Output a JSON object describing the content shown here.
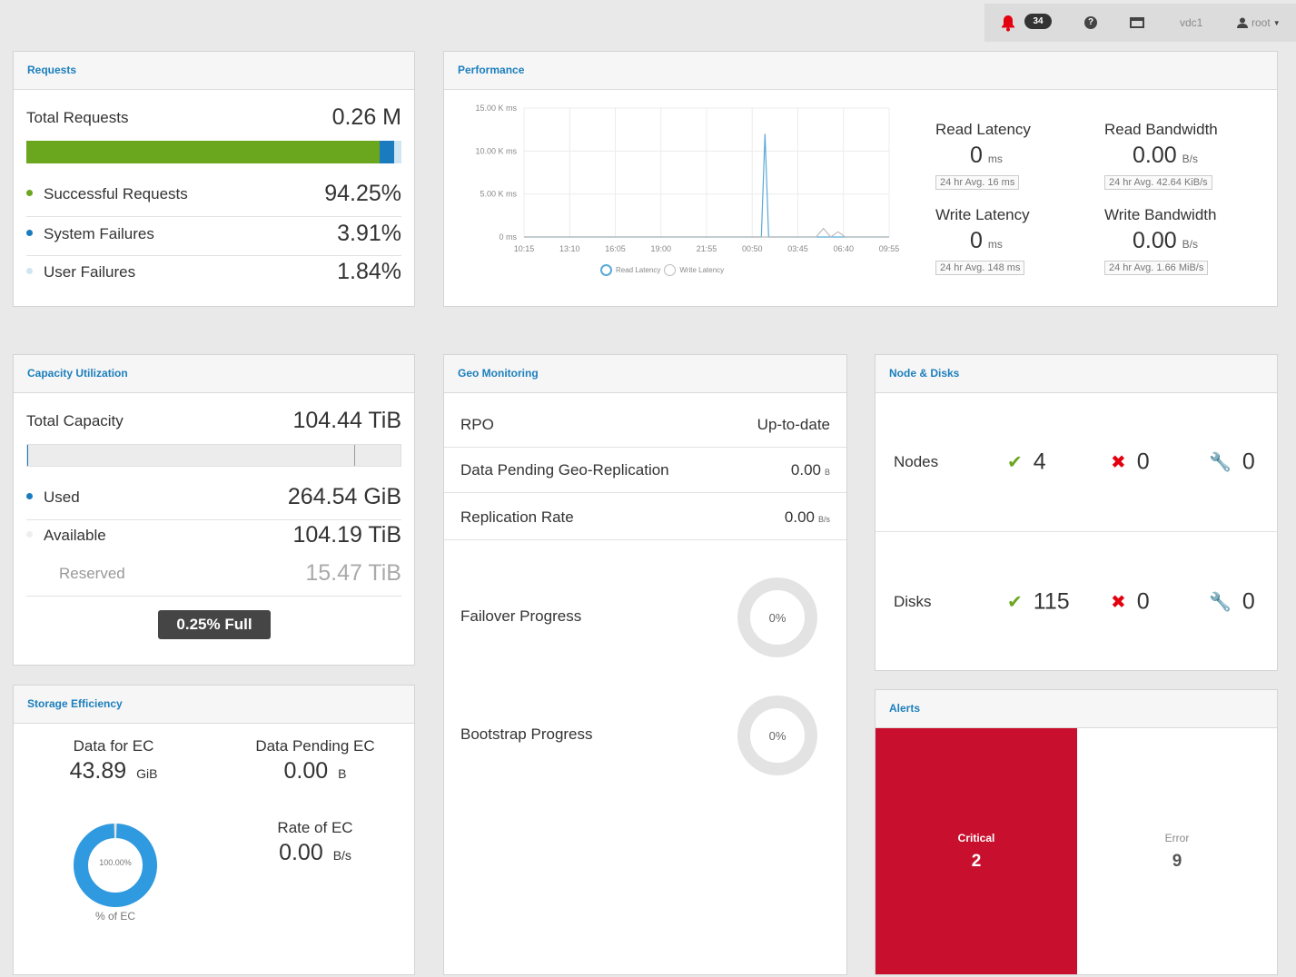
{
  "topbar": {
    "alert_count": "34",
    "vdc": "vdc1",
    "user": "root"
  },
  "requests": {
    "title": "Requests",
    "total_label": "Total Requests",
    "total_value": "0.26 M",
    "bar_fractions": {
      "success": 0.9425,
      "system": 0.0391,
      "user": 0.0184
    },
    "successful_label": "Successful Requests",
    "successful_value": "94.25%",
    "system_label": "System Failures",
    "system_value": "3.91%",
    "user_label": "User Failures",
    "user_value": "1.84%",
    "colors": {
      "success": "#6aa61e",
      "system": "#1a7bbf",
      "user": "#cfe6f2"
    }
  },
  "performance": {
    "title": "Performance",
    "read_latency_label": "Read Latency",
    "read_latency_value": "0",
    "read_latency_unit": "ms",
    "read_latency_avg": "24 hr Avg. 16 ms",
    "write_latency_label": "Write Latency",
    "write_latency_value": "0",
    "write_latency_unit": "ms",
    "write_latency_avg": "24 hr Avg. 148 ms",
    "read_bw_label": "Read Bandwidth",
    "read_bw_value": "0.00",
    "read_bw_unit": "B/s",
    "read_bw_avg": "24 hr Avg. 42.64 KiB/s",
    "write_bw_label": "Write Bandwidth",
    "write_bw_value": "0.00",
    "write_bw_unit": "B/s",
    "write_bw_avg": "24 hr Avg. 1.66 MiB/s",
    "legend_read": "Read Latency",
    "legend_write": "Write Latency"
  },
  "chart_data": {
    "type": "line",
    "x": [
      "10:15",
      "13:10",
      "16:05",
      "19:00",
      "21:55",
      "00:50",
      "03:45",
      "06:40",
      "09:55"
    ],
    "yticks": [
      "15.00 K ms",
      "10.00 K ms",
      "5.00 K ms",
      "0 ms"
    ],
    "ylim": [
      0,
      15000
    ],
    "series": [
      {
        "name": "Read Latency",
        "color": "#5aa9d6",
        "points": [
          [
            0,
            0
          ],
          [
            0.65,
            0
          ],
          [
            0.66,
            12000
          ],
          [
            0.67,
            0
          ],
          [
            1,
            0
          ]
        ]
      },
      {
        "name": "Write Latency",
        "color": "#bbbbbb",
        "points": [
          [
            0,
            0
          ],
          [
            0.8,
            0
          ],
          [
            0.82,
            1000
          ],
          [
            0.84,
            0
          ],
          [
            0.86,
            600
          ],
          [
            0.88,
            0
          ],
          [
            1,
            0
          ]
        ]
      }
    ]
  },
  "capacity": {
    "title": "Capacity Utilization",
    "total_label": "Total Capacity",
    "total_value": "104.44 TiB",
    "used_fraction": 0.0025,
    "used_label": "Used",
    "used_value": "264.54 GiB",
    "available_label": "Available",
    "available_value": "104.19 TiB",
    "reserved_label": "Reserved",
    "reserved_value": "15.47 TiB",
    "full_label": "0.25% Full"
  },
  "geo": {
    "title": "Geo Monitoring",
    "rpo_label": "RPO",
    "rpo_value": "Up-to-date",
    "pending_label": "Data Pending Geo-Replication",
    "pending_value": "0.00",
    "pending_unit": "B",
    "rate_label": "Replication Rate",
    "rate_value": "0.00",
    "rate_unit": "B/s",
    "failover_label": "Failover Progress",
    "failover_value": "0%",
    "bootstrap_label": "Bootstrap Progress",
    "bootstrap_value": "0%"
  },
  "nodes": {
    "title": "Node & Disks",
    "nodes_label": "Nodes",
    "nodes_ok": "4",
    "nodes_bad": "0",
    "nodes_maint": "0",
    "disks_label": "Disks",
    "disks_ok": "115",
    "disks_bad": "0",
    "disks_maint": "0"
  },
  "efficiency": {
    "title": "Storage Efficiency",
    "data_for_ec_label": "Data for EC",
    "data_for_ec_value": "43.89",
    "data_for_ec_unit": "GiB",
    "pending_ec_label": "Data Pending EC",
    "pending_ec_value": "0.00",
    "pending_ec_unit": "B",
    "rate_ec_label": "Rate of EC",
    "rate_ec_value": "0.00",
    "rate_ec_unit": "B/s",
    "donut_value": "100.00%",
    "donut_fraction": 1.0,
    "donut_caption": "% of EC"
  },
  "alerts": {
    "title": "Alerts",
    "critical_label": "Critical",
    "critical_count": "2",
    "error_label": "Error",
    "error_count": "9",
    "critical_color": "#c8102e"
  }
}
